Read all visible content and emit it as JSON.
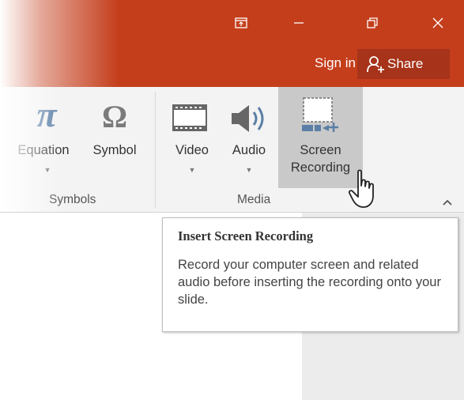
{
  "titlebar": {
    "window_controls": [
      "ribbon-display-options-icon",
      "minimize-icon",
      "restore-icon",
      "close-icon"
    ],
    "sign_in": "Sign in",
    "share": "Share"
  },
  "ribbon": {
    "symbols_group": {
      "label": "Symbols",
      "equation": "Equation",
      "symbol": "Symbol"
    },
    "media_group": {
      "label": "Media",
      "video": "Video",
      "audio": "Audio",
      "screen_recording_line1": "Screen",
      "screen_recording_line2": "Recording"
    }
  },
  "tooltip": {
    "title": "Insert Screen Recording",
    "body": "Record your computer screen and related audio before inserting the recording onto your slide."
  },
  "colors": {
    "titlebar": "#c43e1c",
    "share_button": "#a6331a",
    "ribbon": "#f3f3f3",
    "hover": "#c9c9c9",
    "icon_gray": "#7a7a7a",
    "icon_blue": "#5b7fa6"
  }
}
